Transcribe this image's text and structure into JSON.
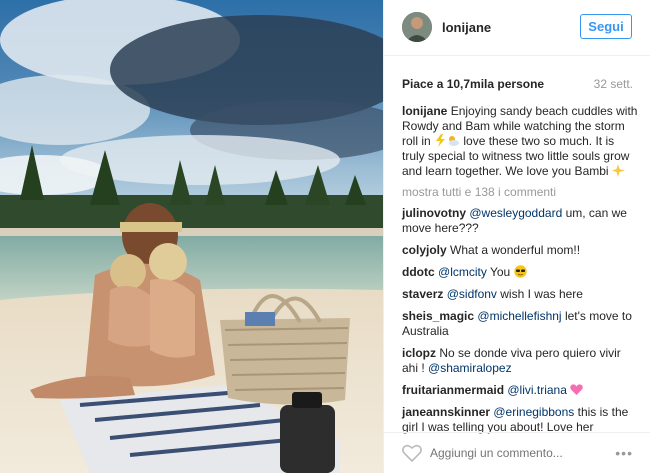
{
  "post": {
    "username": "lonijane",
    "follow_label": "Segui",
    "likes_text": "Piace a 10,7mila persone",
    "time_text": "32 sett.",
    "caption": {
      "author": "lonijane",
      "text_part1": "Enjoying sandy beach cuddles with Rowdy and Bam while watching the storm roll in",
      "text_part2": "love these two so much. It is truly special to witness two little souls grow and learn together. We love you Bambi"
    },
    "load_more_text": "mostra tutti e 138 i commenti",
    "comments": [
      {
        "user": "julinovotny",
        "mention": "@wesleygoddard",
        "text": "um, can we move here???"
      },
      {
        "user": "colyjoly",
        "mention": "",
        "text": "What a wonderful mom!!"
      },
      {
        "user": "ddotc",
        "mention": "@lcmcity",
        "text": "You"
      },
      {
        "user": "staverz",
        "mention": "@sidfonv",
        "text": "wish I was here"
      },
      {
        "user": "sheis_magic",
        "mention": "@michellefishnj",
        "text": "let's move to Australia"
      },
      {
        "user": "iclopz",
        "mention": "",
        "text": "No se donde viva pero quiero vivir ahi !",
        "mention_after": "@shamiralopez"
      },
      {
        "user": "fruitarianmermaid",
        "mention": "@livi.triana",
        "text": ""
      },
      {
        "user": "janeannskinner",
        "mention": "@erinegibbons",
        "text": "this is the girl I was telling you about! Love her"
      }
    ],
    "add_comment_placeholder": "Aggiungi un commento...",
    "more_options": "•••"
  },
  "icons": {
    "heart": "heart-outline-icon",
    "lightning": "lightning-emoji",
    "cloud": "cloud-emoji",
    "sparkles": "sparkles-emoji",
    "sunglasses": "sunglasses-emoji",
    "heart_emoji": "pink-heart-emoji"
  },
  "colors": {
    "follow_blue": "#3897f0",
    "mention_blue": "#003569",
    "muted": "#999999"
  }
}
